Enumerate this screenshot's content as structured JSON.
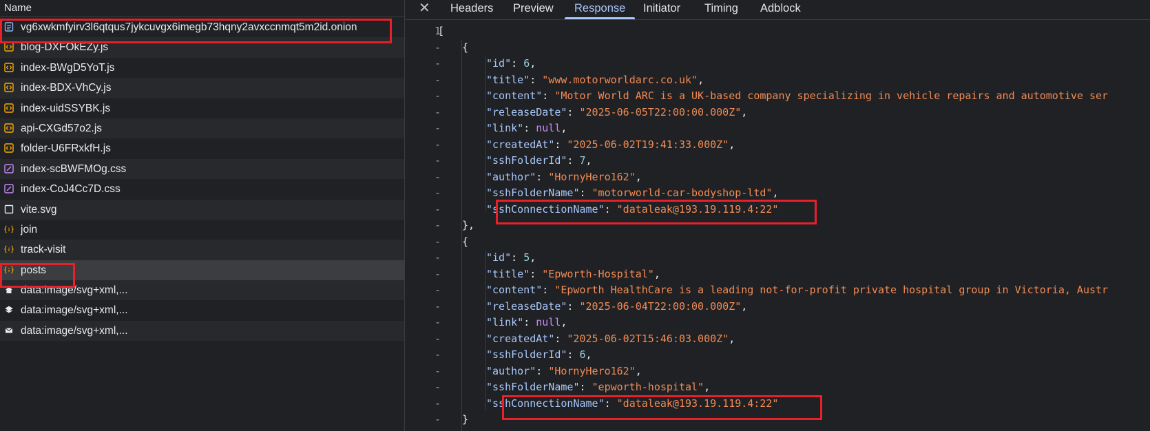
{
  "name_panel": {
    "header": "Name",
    "requests": [
      {
        "name": "vg6xwkmfyirv3l6qtqus7jykcuvgx6imegb73hqny2avxccnmqt5m2id.onion",
        "icon": "document-icon",
        "color": "#8ab4f8"
      },
      {
        "name": "blog-DXFOkEZy.js",
        "icon": "script-icon",
        "color": "#f9ab00"
      },
      {
        "name": "index-BWgD5YoT.js",
        "icon": "script-icon",
        "color": "#f9ab00"
      },
      {
        "name": "index-BDX-VhCy.js",
        "icon": "script-icon",
        "color": "#f9ab00"
      },
      {
        "name": "index-uidSSYBK.js",
        "icon": "script-icon",
        "color": "#f9ab00"
      },
      {
        "name": "api-CXGd57o2.js",
        "icon": "script-icon",
        "color": "#f9ab00"
      },
      {
        "name": "folder-U6FRxkfH.js",
        "icon": "script-icon",
        "color": "#f9ab00"
      },
      {
        "name": "index-scBWFMOg.css",
        "icon": "stylesheet-icon",
        "color": "#c58af9"
      },
      {
        "name": "index-CoJ4Cc7D.css",
        "icon": "stylesheet-icon",
        "color": "#c58af9"
      },
      {
        "name": "vite.svg",
        "icon": "image-file-icon",
        "color": "#e8eaed"
      },
      {
        "name": "join",
        "icon": "fetch-icon",
        "color": "#f9ab00"
      },
      {
        "name": "track-visit",
        "icon": "fetch-icon",
        "color": "#f9ab00"
      },
      {
        "name": "posts",
        "icon": "fetch-icon",
        "color": "#f9ab00"
      },
      {
        "name": "data:image/svg+xml,...",
        "icon": "home-icon",
        "color": "#e8eaed"
      },
      {
        "name": "data:image/svg+xml,...",
        "icon": "layers-icon",
        "color": "#e8eaed"
      },
      {
        "name": "data:image/svg+xml,...",
        "icon": "mail-icon",
        "color": "#e8eaed"
      }
    ],
    "selected_index": 12
  },
  "tabs": {
    "close": "✕",
    "items": [
      "Headers",
      "Preview",
      "Response",
      "Initiator",
      "Timing",
      "Adblock"
    ],
    "active": "Response"
  },
  "response": {
    "lines": [
      {
        "gutter": "1",
        "indent": 0,
        "text": "["
      },
      {
        "gutter": "-",
        "indent": 1,
        "text": "{"
      },
      {
        "gutter": "-",
        "indent": 2,
        "key": "id",
        "value": "6",
        "vtype": "n"
      },
      {
        "gutter": "-",
        "indent": 2,
        "key": "title",
        "value": "\"www.motorworldarc.co.uk\"",
        "vtype": "s"
      },
      {
        "gutter": "-",
        "indent": 2,
        "key": "content",
        "value": "\"Motor World ARC is a UK-based company specializing in vehicle repairs and automotive ser",
        "vtype": "s",
        "nocomma": true
      },
      {
        "gutter": "-",
        "indent": 2,
        "key": "releaseDate",
        "value": "\"2025-06-05T22:00:00.000Z\"",
        "vtype": "s"
      },
      {
        "gutter": "-",
        "indent": 2,
        "key": "link",
        "value": "null",
        "vtype": "nl"
      },
      {
        "gutter": "-",
        "indent": 2,
        "key": "createdAt",
        "value": "\"2025-06-02T19:41:33.000Z\"",
        "vtype": "s"
      },
      {
        "gutter": "-",
        "indent": 2,
        "key": "sshFolderId",
        "value": "7",
        "vtype": "n"
      },
      {
        "gutter": "-",
        "indent": 2,
        "key": "author",
        "value": "\"HornyHero162\"",
        "vtype": "s"
      },
      {
        "gutter": "-",
        "indent": 2,
        "key": "sshFolderName",
        "value": "\"motorworld-car-bodyshop-ltd\"",
        "vtype": "s"
      },
      {
        "gutter": "-",
        "indent": 2,
        "key": "sshConnectionName",
        "value": "\"dataleak@193.19.119.4:22\"",
        "vtype": "s",
        "nocomma": true
      },
      {
        "gutter": "-",
        "indent": 1,
        "text": "},"
      },
      {
        "gutter": "-",
        "indent": 1,
        "text": "{"
      },
      {
        "gutter": "-",
        "indent": 2,
        "key": "id",
        "value": "5",
        "vtype": "n"
      },
      {
        "gutter": "-",
        "indent": 2,
        "key": "title",
        "value": "\"Epworth-Hospital\"",
        "vtype": "s"
      },
      {
        "gutter": "-",
        "indent": 2,
        "key": "content",
        "value": "\"Epworth HealthCare is a leading not-for-profit private hospital group in Victoria, Austr",
        "vtype": "s",
        "nocomma": true
      },
      {
        "gutter": "-",
        "indent": 2,
        "key": "releaseDate",
        "value": "\"2025-06-04T22:00:00.000Z\"",
        "vtype": "s"
      },
      {
        "gutter": "-",
        "indent": 2,
        "key": "link",
        "value": "null",
        "vtype": "nl"
      },
      {
        "gutter": "-",
        "indent": 2,
        "key": "createdAt",
        "value": "\"2025-06-02T15:46:03.000Z\"",
        "vtype": "s"
      },
      {
        "gutter": "-",
        "indent": 2,
        "key": "sshFolderId",
        "value": "6",
        "vtype": "n"
      },
      {
        "gutter": "-",
        "indent": 2,
        "key": "author",
        "value": "\"HornyHero162\"",
        "vtype": "s"
      },
      {
        "gutter": "-",
        "indent": 2,
        "key": "sshFolderName",
        "value": "\"epworth-hospital\"",
        "vtype": "s"
      },
      {
        "gutter": "-",
        "indent": 2,
        "key": "sshConnectionName",
        "value": "\"dataleak@193.19.119.4:22\"",
        "vtype": "s",
        "nocomma": true
      },
      {
        "gutter": "-",
        "indent": 1,
        "text": "}"
      }
    ]
  },
  "colors": {
    "highlight": "#e8202a",
    "key": "#a8c7fa",
    "string": "#f28b54",
    "number": "#99ccdd",
    "null": "#c58af9",
    "active_tab": "#a8c7fa"
  }
}
